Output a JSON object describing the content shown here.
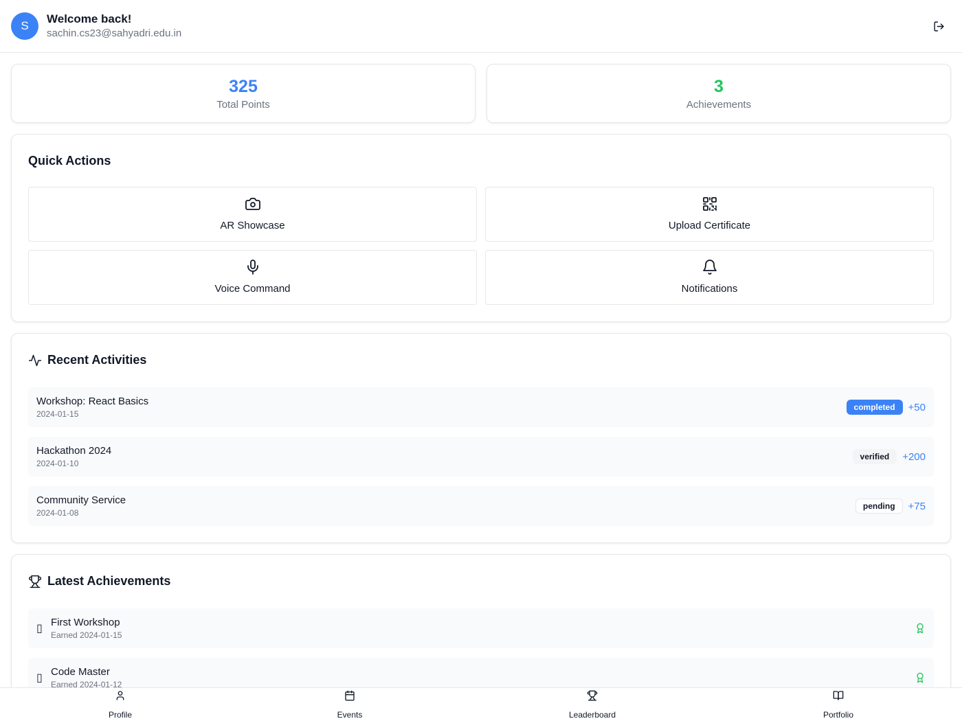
{
  "header": {
    "avatar_initial": "S",
    "title": "Welcome back!",
    "email": "sachin.cs23@sahyadri.edu.in",
    "logout_icon": "log-out-icon"
  },
  "stats": [
    {
      "value": "325",
      "label": "Total Points",
      "color": "#3b82f6"
    },
    {
      "value": "3",
      "label": "Achievements",
      "color": "#22c55e"
    }
  ],
  "quick_actions": {
    "title": "Quick Actions",
    "items": [
      {
        "label": "AR Showcase",
        "icon": "camera-icon"
      },
      {
        "label": "Upload Certificate",
        "icon": "qr-code-icon"
      },
      {
        "label": "Voice Command",
        "icon": "microphone-icon"
      },
      {
        "label": "Notifications",
        "icon": "bell-icon"
      }
    ]
  },
  "recent_activities": {
    "title": "Recent Activities",
    "items": [
      {
        "title": "Workshop: React Basics",
        "date": "2024-01-15",
        "status": "completed",
        "points": "+50"
      },
      {
        "title": "Hackathon 2024",
        "date": "2024-01-10",
        "status": "verified",
        "points": "+200"
      },
      {
        "title": "Community Service",
        "date": "2024-01-08",
        "status": "pending",
        "points": "+75"
      }
    ]
  },
  "latest_achievements": {
    "title": "Latest Achievements",
    "items": [
      {
        "glyph": "▯",
        "title": "First Workshop",
        "earned": "Earned 2024-01-15"
      },
      {
        "glyph": "▯",
        "title": "Code Master",
        "earned": "Earned 2024-01-12"
      }
    ]
  },
  "bottom_nav": [
    {
      "label": "Profile",
      "icon": "user-icon"
    },
    {
      "label": "Events",
      "icon": "calendar-icon"
    },
    {
      "label": "Leaderboard",
      "icon": "trophy-icon"
    },
    {
      "label": "Portfolio",
      "icon": "book-open-icon"
    }
  ],
  "colors": {
    "accent": "#3b82f6",
    "success": "#22c55e",
    "border": "#e5e7eb",
    "muted_text": "#6b7280"
  }
}
